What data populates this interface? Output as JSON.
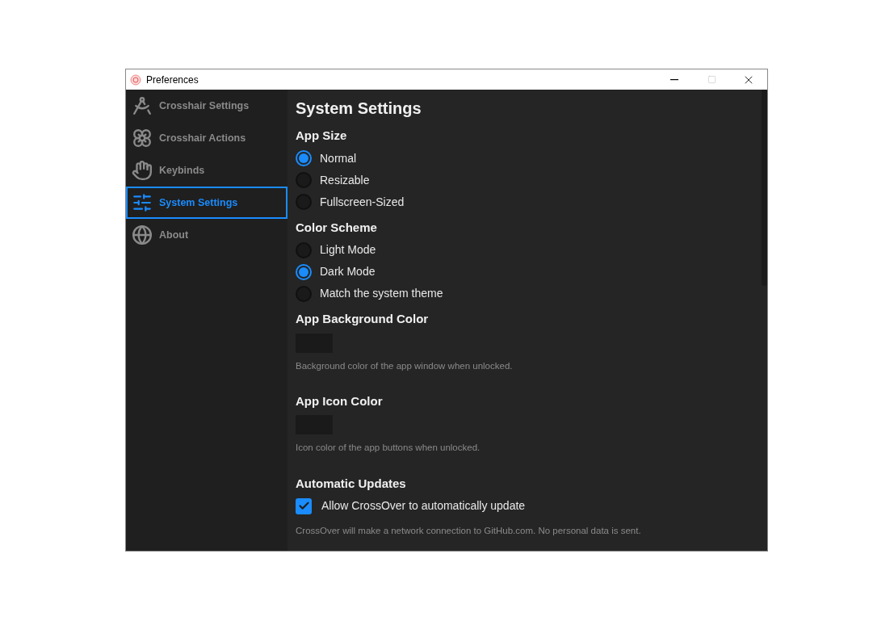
{
  "window": {
    "title": "Preferences"
  },
  "sidebar": {
    "items": [
      {
        "label": "Crosshair Settings",
        "selected": false
      },
      {
        "label": "Crosshair Actions",
        "selected": false
      },
      {
        "label": "Keybinds",
        "selected": false
      },
      {
        "label": "System Settings",
        "selected": true
      },
      {
        "label": "About",
        "selected": false
      }
    ]
  },
  "content": {
    "title": "System Settings",
    "sections": [
      {
        "kind": "radio",
        "heading": "App Size",
        "options": [
          {
            "label": "Normal",
            "selected": true
          },
          {
            "label": "Resizable",
            "selected": false
          },
          {
            "label": "Fullscreen-Sized",
            "selected": false
          }
        ]
      },
      {
        "kind": "radio",
        "heading": "Color Scheme",
        "options": [
          {
            "label": "Light Mode",
            "selected": false
          },
          {
            "label": "Dark Mode",
            "selected": true
          },
          {
            "label": "Match the system theme",
            "selected": false
          }
        ]
      },
      {
        "kind": "color",
        "heading": "App Background Color",
        "color": "#1a1a1a",
        "hint": "Background color of the app window when unlocked."
      },
      {
        "kind": "color",
        "heading": "App Icon Color",
        "color": "#1a1a1a",
        "hint": "Icon color of the app buttons when unlocked."
      },
      {
        "kind": "checkbox",
        "heading": "Automatic Updates",
        "label": "Allow CrossOver to automatically update",
        "checked": true,
        "hint": "CrossOver will make a network connection to GitHub.com. No personal data is sent."
      }
    ]
  }
}
